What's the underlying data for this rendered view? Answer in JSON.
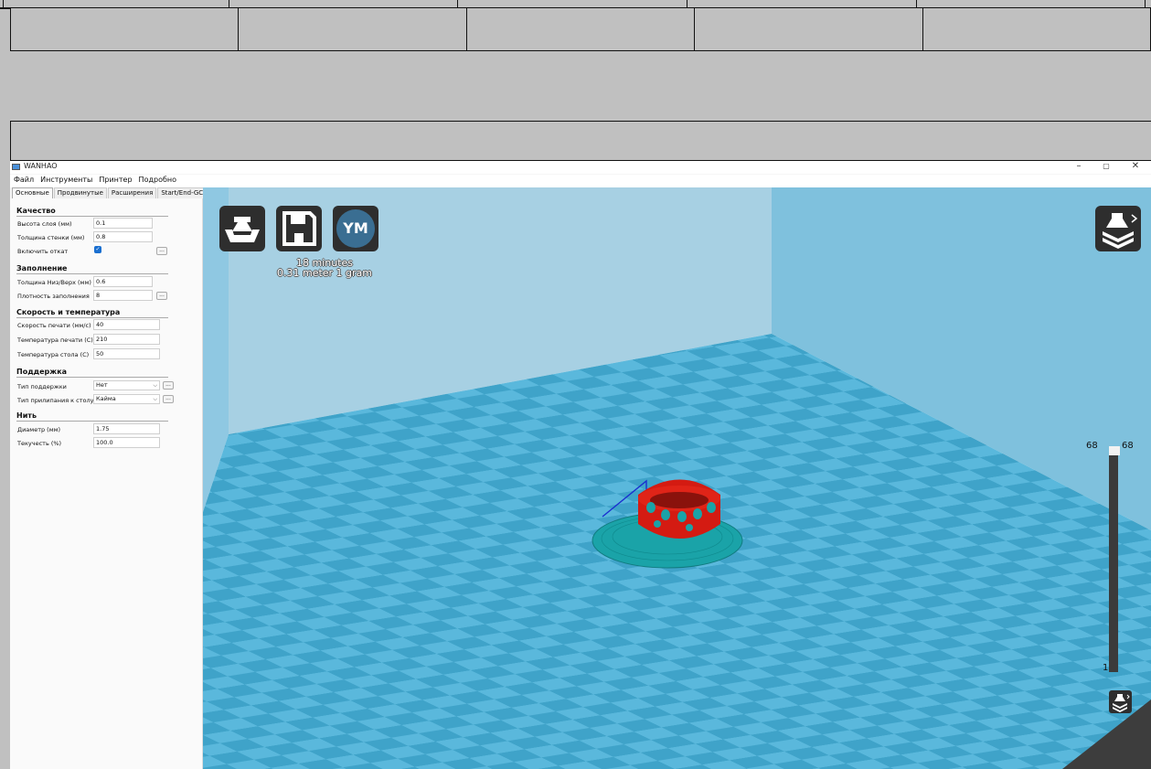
{
  "window": {
    "title": "WANHAO",
    "controls": {
      "minimize": "–",
      "maximize": "▢",
      "close": "✕"
    }
  },
  "menu": [
    "Файл",
    "Инструменты",
    "Принтер",
    "Подробно"
  ],
  "tabs": [
    "Основные",
    "Продвинутые",
    "Расширения",
    "Start/End-GCode"
  ],
  "settings": {
    "quality": {
      "title": "Качество",
      "layer_height_label": "Высота слоя (мм)",
      "layer_height": "0.1",
      "wall_thickness_label": "Толщина стенки (мм)",
      "wall_thickness": "0.8",
      "retraction_label": "Включить откат",
      "retraction_enabled": true
    },
    "fill": {
      "title": "Заполнение",
      "bottom_top_label": "Толщина Низ/Верх (мм)",
      "bottom_top": "0.6",
      "density_label": "Плотность заполнения",
      "density": "8"
    },
    "speed": {
      "title": "Скорость и температура",
      "print_speed_label": "Скорость печати (мм/с)",
      "print_speed": "40",
      "print_temp_label": "Температура печати (C)",
      "print_temp": "210",
      "bed_temp_label": "Температура стола (C)",
      "bed_temp": "50"
    },
    "support": {
      "title": "Поддержка",
      "support_type_label": "Тип поддержки",
      "support_type": "Нет",
      "adhesion_label": "Тип прилипания к столу",
      "adhesion": "Кайма"
    },
    "filament": {
      "title": "Нить",
      "diameter_label": "Диаметр (мм)",
      "diameter": "1.75",
      "flow_label": "Текучесть (%)",
      "flow": "100.0"
    },
    "more_button": "..."
  },
  "viewport": {
    "ym_label": "YM",
    "print_time": "18 minutes",
    "print_material": "0.31 meter 1 gram",
    "layer_top_left": "68",
    "layer_top_right": "68",
    "layer_bottom": "1",
    "colors": {
      "floor": "#5ab8dc",
      "wall": "#a8d2e4",
      "model": "#d41b12",
      "brim": "#1aa3a8"
    }
  }
}
